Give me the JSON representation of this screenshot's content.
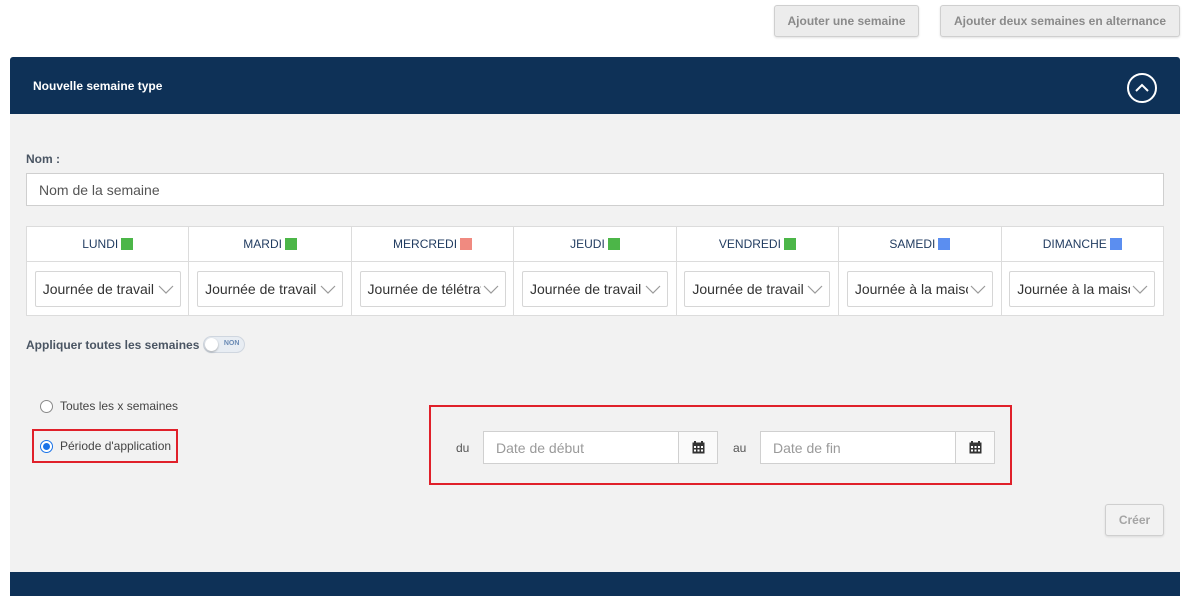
{
  "top_actions": {
    "add_week": "Ajouter une semaine",
    "add_two_weeks": "Ajouter deux semaines en alternance"
  },
  "panel": {
    "title": "Nouvelle semaine type",
    "collapse_icon": "chevron-up-icon",
    "header_color": "#0e3157"
  },
  "form": {
    "name_label": "Nom :",
    "name_placeholder": "Nom de la semaine",
    "days": [
      {
        "name": "LUNDI",
        "color": "#4cb648",
        "value": "Journée de travail"
      },
      {
        "name": "MARDI",
        "color": "#4cb648",
        "value": "Journée de travail"
      },
      {
        "name": "MERCREDI",
        "color": "#f08a80",
        "value": "Journée de télétravail"
      },
      {
        "name": "JEUDI",
        "color": "#4cb648",
        "value": "Journée de travail"
      },
      {
        "name": "VENDREDI",
        "color": "#4cb648",
        "value": "Journée de travail"
      },
      {
        "name": "SAMEDI",
        "color": "#5b8ef0",
        "value": "Journée à la maison"
      },
      {
        "name": "DIMANCHE",
        "color": "#5b8ef0",
        "value": "Journée à la maison"
      }
    ],
    "apply_all_label": "Appliquer toutes les semaines",
    "apply_all_toggle": "NON",
    "radio_every_x": "Toutes les x semaines",
    "radio_period": "Période d'application",
    "selected_radio": "period",
    "date_from_label": "du",
    "date_from_placeholder": "Date de début",
    "date_to_label": "au",
    "date_to_placeholder": "Date de fin",
    "calendar_icon": "calendar-icon",
    "create_label": "Créer"
  },
  "highlight_color": "#e0202a"
}
